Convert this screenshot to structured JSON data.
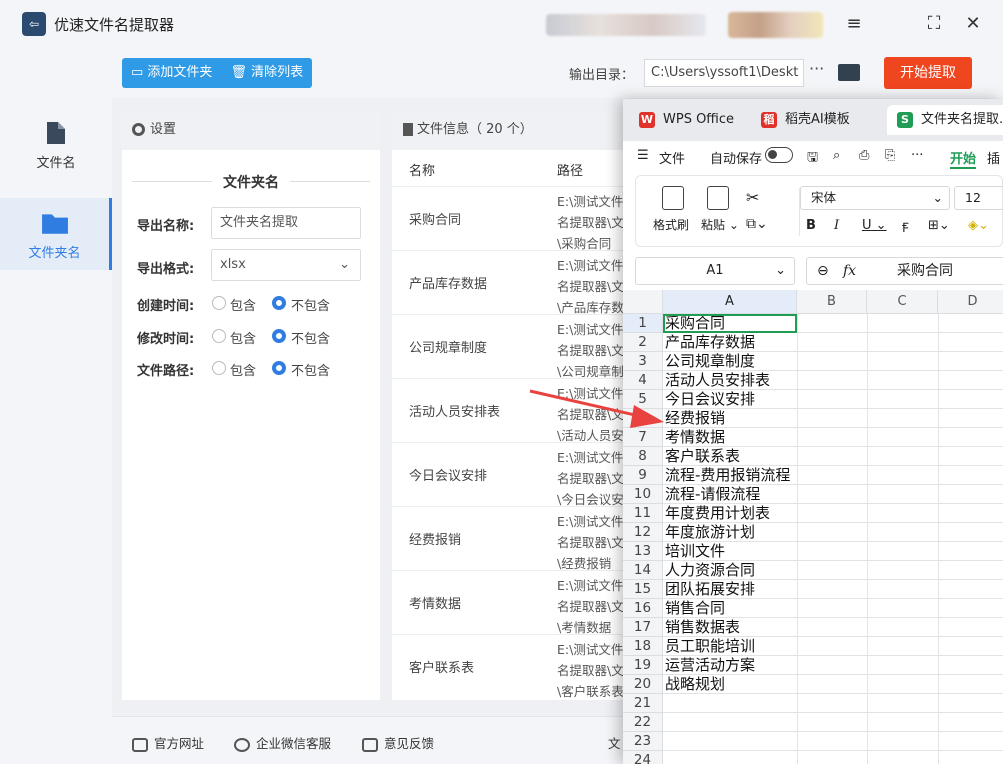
{
  "app": {
    "title": "优速文件名提取器",
    "window_controls": [
      "menu-icon",
      "maximize-icon",
      "close-icon"
    ]
  },
  "sidebar": {
    "items": [
      {
        "label": "文件名",
        "icon": "file-icon",
        "active": false
      },
      {
        "label": "文件夹名",
        "icon": "folder-icon",
        "active": true
      }
    ]
  },
  "toolbar": {
    "add_folder": "添加文件夹",
    "clear_list": "清除列表",
    "output_label": "输出目录：",
    "output_path": "C:\\Users\\yssoft1\\Deskt",
    "more": "···",
    "start": "开始提取"
  },
  "settings": {
    "header": "设置",
    "section_title": "文件夹名",
    "export_name_label": "导出名称:",
    "export_name_value": "文件夹名提取",
    "export_format_label": "导出格式:",
    "export_format_value": "xlsx",
    "created_label": "创建时间:",
    "modified_label": "修改时间:",
    "path_label": "文件路径:",
    "opt_include": "包含",
    "opt_exclude": "不包含"
  },
  "fileinfo": {
    "header": "文件信息（ 20 个）",
    "col_name": "名称",
    "col_path": "路径",
    "rows": [
      {
        "name": "采购合同",
        "p1": "E:\\测试文件",
        "p2": "名提取器\\文",
        "p3": "\\采购合同"
      },
      {
        "name": "产品库存数据",
        "p1": "E:\\测试文件",
        "p2": "名提取器\\文",
        "p3": "\\产品库存数"
      },
      {
        "name": "公司规章制度",
        "p1": "E:\\测试文件",
        "p2": "名提取器\\文",
        "p3": "\\公司规章制"
      },
      {
        "name": "活动人员安排表",
        "p1": "E:\\测试文件",
        "p2": "名提取器\\文",
        "p3": "\\活动人员安"
      },
      {
        "name": "今日会议安排",
        "p1": "E:\\测试文件",
        "p2": "名提取器\\文",
        "p3": "\\今日会议安"
      },
      {
        "name": "经费报销",
        "p1": "E:\\测试文件",
        "p2": "名提取器\\文",
        "p3": "\\经费报销"
      },
      {
        "name": "考情数据",
        "p1": "E:\\测试文件",
        "p2": "名提取器\\文",
        "p3": "\\考情数据"
      },
      {
        "name": "客户联系表",
        "p1": "E:\\测试文件",
        "p2": "名提取器\\文",
        "p3": "\\客户联系表"
      }
    ]
  },
  "footer": {
    "website": "官方网址",
    "wechat": "企业微信客服",
    "feedback": "意见反馈",
    "partial": "文"
  },
  "wps": {
    "tabs": [
      {
        "label": "WPS Office",
        "icon_color": "#e0312b",
        "icon": "W"
      },
      {
        "label": "稻壳AI模板",
        "icon_color": "#e0312b",
        "icon": "稻"
      },
      {
        "label": "文件夹名提取.x",
        "icon_color": "#1f9d55",
        "icon": "S"
      }
    ],
    "menu": {
      "file": "文件",
      "autosave": "自动保存",
      "more": "···",
      "start": "开始",
      "insert": "插"
    },
    "ribbon": {
      "format_painter": "格式刷",
      "paste": "粘贴",
      "font_name": "宋体",
      "font_size": "12",
      "bold": "B",
      "italic": "I",
      "underline": "U"
    },
    "namebox": "A1",
    "fx": "fx",
    "formula": "采购合同",
    "columns": [
      "A",
      "B",
      "C",
      "D"
    ],
    "rows": [
      "1",
      "2",
      "3",
      "4",
      "5",
      "6",
      "7",
      "8",
      "9",
      "10",
      "11",
      "12",
      "13",
      "14",
      "15",
      "16",
      "17",
      "18",
      "19",
      "20",
      "21",
      "22",
      "23",
      "24"
    ],
    "cells": [
      "采购合同",
      "产品库存数据",
      "公司规章制度",
      "活动人员安排表",
      "今日会议安排",
      "经费报销",
      "考情数据",
      "客户联系表",
      "流程-费用报销流程",
      "流程-请假流程",
      "年度费用计划表",
      "年度旅游计划",
      "培训文件",
      "人力资源合同",
      "团队拓展安排",
      "销售合同",
      "销售数据表",
      "员工职能培训",
      "运营活动方案",
      "战略规划"
    ]
  },
  "colors": {
    "accent_blue": "#2f7de1",
    "button_blue": "#2f9be6",
    "start_red": "#f0461f",
    "arrow_red": "#e8433f",
    "wps_green": "#1f9d55"
  }
}
